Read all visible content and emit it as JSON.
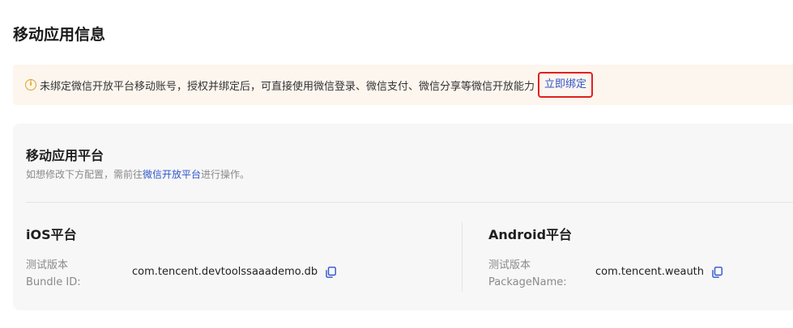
{
  "page": {
    "title": "移动应用信息"
  },
  "notice": {
    "icon": "info-circle-icon",
    "text": "未绑定微信开放平台移动账号，授权并绑定后，可直接使用微信登录、微信支付、微信分享等微信开放能力",
    "bind_link": "立即绑定",
    "colors": {
      "background": "#fdf6ef",
      "icon": "#e3a21a",
      "highlight_border": "#e02020",
      "link": "#2f54c9"
    }
  },
  "panel": {
    "title": "移动应用平台",
    "subtitle_prefix": "如想修改下方配置，需前往",
    "subtitle_link": "微信开放平台",
    "subtitle_suffix": "进行操作。"
  },
  "ios": {
    "title": "iOS平台",
    "label_line1": "测试版本",
    "label_line2": "Bundle ID:",
    "value": "com.tencent.devtoolssaaademo.db",
    "copy_icon": "copy-icon"
  },
  "android": {
    "title": "Android平台",
    "label_line1": "测试版本",
    "label_line2": "PackageName:",
    "value": "com.tencent.weauth",
    "copy_icon": "copy-icon"
  }
}
